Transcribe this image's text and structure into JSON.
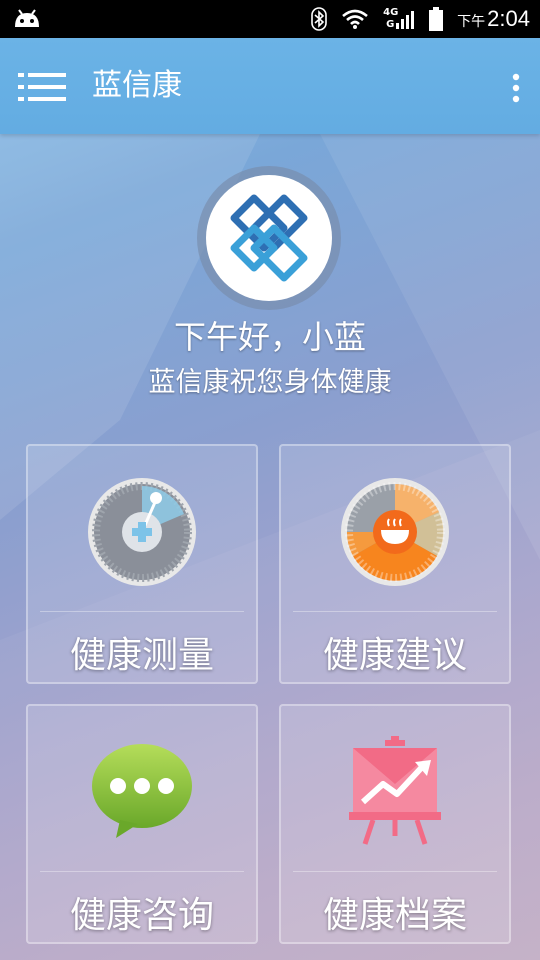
{
  "status_bar": {
    "network": "4G",
    "ampm": "下午",
    "time": "2:04"
  },
  "app_bar": {
    "title": "蓝信康"
  },
  "header": {
    "greeting": "下午好，小蓝",
    "subtitle": "蓝信康祝您身体健康"
  },
  "tiles": [
    {
      "label": "健康测量",
      "icon": "measurement-gauge-icon"
    },
    {
      "label": "健康建议",
      "icon": "food-advice-icon"
    },
    {
      "label": "健康咨询",
      "icon": "chat-bubble-icon"
    },
    {
      "label": "健康档案",
      "icon": "chart-board-icon"
    }
  ],
  "colors": {
    "app_bar": "#63ace2",
    "status_bar": "#000000",
    "chat_green": "#8cc63f",
    "record_pink": "#f26b86",
    "advice_orange": "#f7851e",
    "measure_blue": "#7dc3e8"
  }
}
